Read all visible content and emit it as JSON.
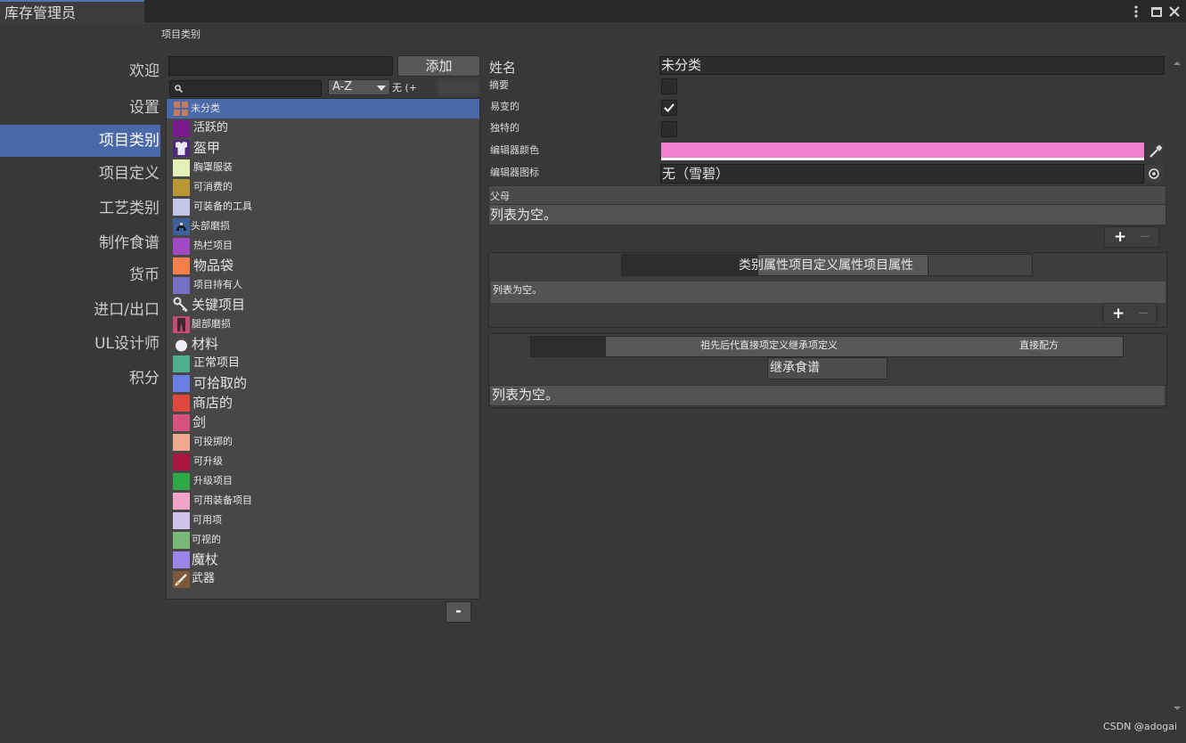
{
  "window": {
    "title": "库存管理员"
  },
  "nav": {
    "items": [
      {
        "label": "欢迎"
      },
      {
        "label": "设置"
      },
      {
        "label": "项目类别"
      },
      {
        "label": "项目定义"
      },
      {
        "label": "工艺类别"
      },
      {
        "label": "制作食谱"
      },
      {
        "label": "货币"
      },
      {
        "label": "进口/出口"
      },
      {
        "label": "UL设计师"
      },
      {
        "label": "积分"
      }
    ],
    "active_index": 2,
    "active_color": "#4a69a8"
  },
  "section": {
    "heading": "项目类别"
  },
  "list": {
    "add_label": "添加",
    "sort_value": "A-Z",
    "filter_text": "无 (+",
    "remove_label": "-",
    "items": [
      {
        "label": "未分类",
        "color": "#c97a58"
      },
      {
        "label": "活跃的",
        "color": "#7a1a8c"
      },
      {
        "label": "盔甲",
        "color": "#7a3fa8"
      },
      {
        "label": "胸罩服装",
        "color": "#e3f0b8"
      },
      {
        "label": "可消费的",
        "color": "#b99833"
      },
      {
        "label": "可装备的工具",
        "color": "#c2c7e8"
      },
      {
        "label": "头部磨损",
        "color": "#3f5f9a"
      },
      {
        "label": "热栏项目",
        "color": "#a348c4"
      },
      {
        "label": "物品袋",
        "color": "#f57e4a"
      },
      {
        "label": "项目持有人",
        "color": "#7671c4"
      },
      {
        "label": "关键项目",
        "color": "#cfcfcf"
      },
      {
        "label": "腿部磨损",
        "color": "#c24e75"
      },
      {
        "label": "材料",
        "color": "#d9d9e6"
      },
      {
        "label": "正常项目",
        "color": "#4fae8c"
      },
      {
        "label": "可拾取的",
        "color": "#6b7ee8"
      },
      {
        "label": "商店的",
        "color": "#e0483d"
      },
      {
        "label": "剑",
        "color": "#d6517f"
      },
      {
        "label": "可投掷的",
        "color": "#f0a88e"
      },
      {
        "label": "可升级",
        "color": "#a8153f"
      },
      {
        "label": "升级项目",
        "color": "#2fa848"
      },
      {
        "label": "可用装备项目",
        "color": "#f2a3c8"
      },
      {
        "label": "可用项",
        "color": "#d0c4e8"
      },
      {
        "label": "可视的",
        "color": "#78b878"
      },
      {
        "label": "魔杖",
        "color": "#9b84ea"
      },
      {
        "label": "武器",
        "color": "#b08449"
      }
    ]
  },
  "detail": {
    "name_label": "姓名",
    "name_value": "未分类",
    "summary_label": "摘要",
    "mutable_label": "易变的",
    "mutable_checked": true,
    "unique_label": "独特的",
    "editor_color_label": "编辑器颜色",
    "editor_color": "#f07fcf",
    "editor_icon_label": "编辑器图标",
    "editor_icon_value": "无（雪碧）",
    "parent_label": "父母",
    "parent_empty": "列表为空。",
    "add_label": "+",
    "remove_label": "−",
    "props_tab_label": "类别属性项目定义属性项目属性",
    "props_empty": "列表为空。",
    "recipes_tab_label": "祖先后代直接项定义继承项定义",
    "direct_recipe_label": "直接配方",
    "inherit_recipe_label": "继承食谱",
    "recipes_empty": "列表为空。"
  },
  "watermark": "CSDN @adogai"
}
